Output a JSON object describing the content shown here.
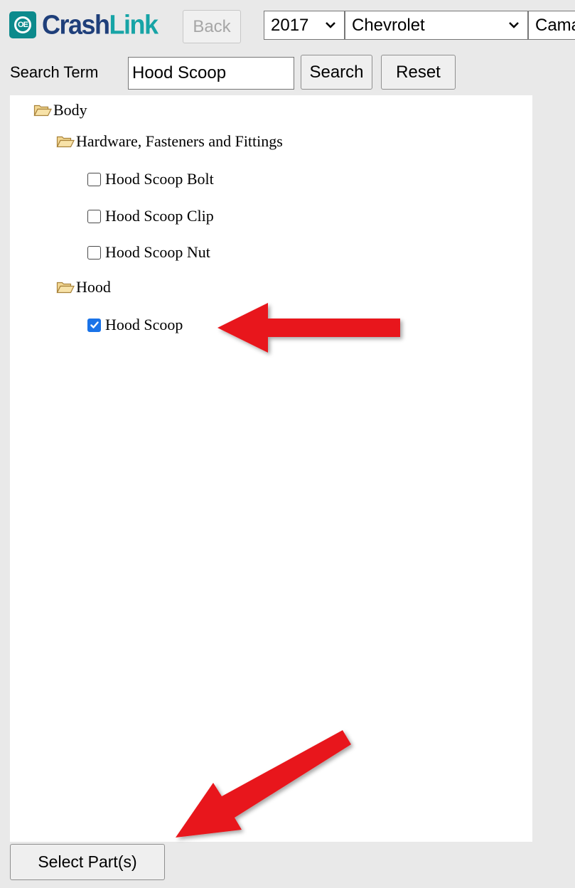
{
  "header": {
    "logo_part1": "Crash",
    "logo_part2": "Link",
    "back_label": "Back",
    "year": "2017",
    "make": "Chevrolet",
    "model": "Cama"
  },
  "search": {
    "label": "Search Term",
    "value": "Hood Scoop",
    "search_label": "Search",
    "reset_label": "Reset"
  },
  "tree": {
    "root_label": "Body",
    "group1_label": "Hardware, Fasteners and Fittings",
    "group1_items": [
      {
        "label": "Hood Scoop Bolt",
        "checked": false
      },
      {
        "label": "Hood Scoop Clip",
        "checked": false
      },
      {
        "label": "Hood Scoop Nut",
        "checked": false
      }
    ],
    "group2_label": "Hood",
    "group2_items": [
      {
        "label": "Hood Scoop",
        "checked": true
      }
    ]
  },
  "footer": {
    "select_label": "Select Part(s)"
  },
  "colors": {
    "annotation_arrow": "#e8191b",
    "checkbox_checked": "#1a73e8",
    "logo_dark": "#1f3f7a",
    "logo_teal": "#17a4a6"
  }
}
